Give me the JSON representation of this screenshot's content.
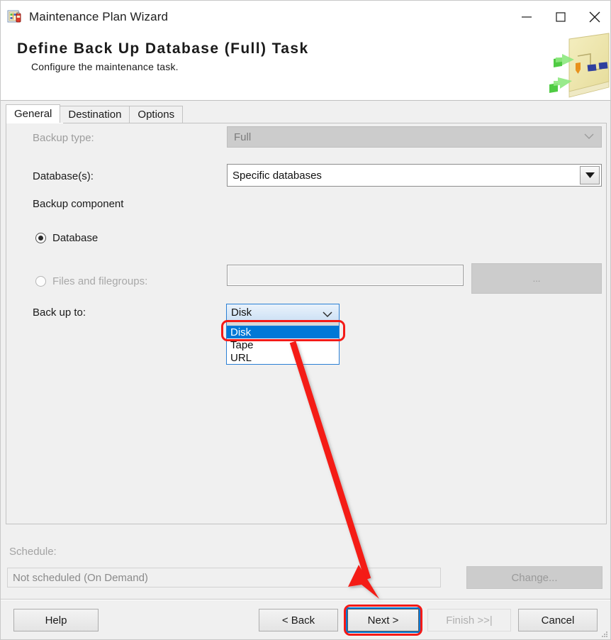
{
  "window": {
    "title": "Maintenance Plan Wizard",
    "icon": "maintenance-plan-icon",
    "controls": {
      "minimize": "minimize-icon",
      "maximize": "maximize-icon",
      "close": "close-icon"
    }
  },
  "banner": {
    "title": "Define Back Up Database (Full) Task",
    "subtitle": "Configure the maintenance task.",
    "artwork": "wizard-banner-graphic"
  },
  "tabs": [
    {
      "label": "General",
      "active": true
    },
    {
      "label": "Destination",
      "active": false
    },
    {
      "label": "Options",
      "active": false
    }
  ],
  "general": {
    "backup_type": {
      "label": "Backup type:",
      "value": "Full",
      "enabled": false
    },
    "databases": {
      "label": "Database(s):",
      "value": "Specific databases",
      "enabled": true
    },
    "backup_component": {
      "label": "Backup component",
      "database_option": "Database",
      "database_checked": true,
      "files_option": "Files and filegroups:",
      "files_checked": false,
      "files_value": "",
      "browse_label": "..."
    },
    "back_up_to": {
      "label": "Back up to:",
      "value": "Disk",
      "expanded": true,
      "options": [
        "Disk",
        "Tape",
        "URL"
      ],
      "selected_index": 0
    }
  },
  "schedule": {
    "label": "Schedule:",
    "value": "Not scheduled (On Demand)",
    "change_label": "Change...",
    "change_enabled": false
  },
  "footer": {
    "help": "Help",
    "back": "< Back",
    "next": "Next >",
    "finish": "Finish >>|",
    "cancel": "Cancel",
    "next_focused": true,
    "finish_enabled": false
  },
  "annotations": {
    "highlight_color": "#f41a17",
    "focus_color": "#0078d7",
    "selection_color": "#0078d7",
    "highlighted_option": "Disk",
    "highlighted_button": "Next >"
  }
}
